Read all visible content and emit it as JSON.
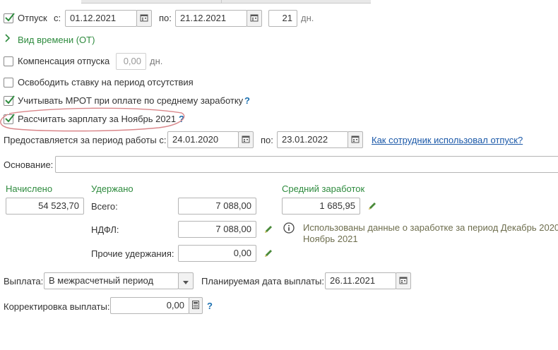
{
  "vacation": {
    "label": "Отпуск",
    "checked": true,
    "from_label": "с:",
    "from_value": "01.12.2021",
    "to_label": "по:",
    "to_value": "21.12.2021",
    "days_value": "21",
    "days_unit": "дн."
  },
  "time_type_link": "Вид времени (ОТ)",
  "compensation": {
    "label": "Компенсация отпуска",
    "checked": false,
    "value": "0,00",
    "unit": "дн."
  },
  "free_rate": {
    "label": "Освободить ставку на период отсутствия",
    "checked": false
  },
  "mrot": {
    "label": "Учитывать МРОТ при оплате по среднему заработку",
    "checked": true,
    "help": "?"
  },
  "calc_salary": {
    "label": "Рассчитать зарплату за Ноябрь 2021",
    "checked": true,
    "help": "?"
  },
  "period": {
    "label": "Предоставляется за период работы с:",
    "from_value": "24.01.2020",
    "to_label": "по:",
    "to_value": "23.01.2022",
    "link": "Как сотрудник использовал отпуск?"
  },
  "basis": {
    "label": "Основание:",
    "value": ""
  },
  "accrued": {
    "header": "Начислено",
    "value": "54 523,70"
  },
  "withheld": {
    "header": "Удержано",
    "total_label": "Всего:",
    "total_value": "7 088,00",
    "ndfl_label": "НДФЛ:",
    "ndfl_value": "7 088,00",
    "other_label": "Прочие удержания:",
    "other_value": "0,00"
  },
  "avg_earnings": {
    "header": "Средний заработок",
    "value": "1 685,95",
    "info_line1": "Использованы данные о заработке за период Декабрь 2020",
    "info_line2": "Ноябрь 2021"
  },
  "payment": {
    "label": "Выплата:",
    "selected": "В межрасчетный период",
    "planned_label": "Планируемая дата выплаты:",
    "planned_value": "26.11.2021"
  },
  "payment_correction": {
    "label": "Корректировка выплаты:",
    "value": "0,00",
    "help": "?"
  },
  "colors": {
    "accent_green": "#2e8b3e",
    "link_blue": "#1a58a8",
    "annotation_red": "#d9868a"
  }
}
